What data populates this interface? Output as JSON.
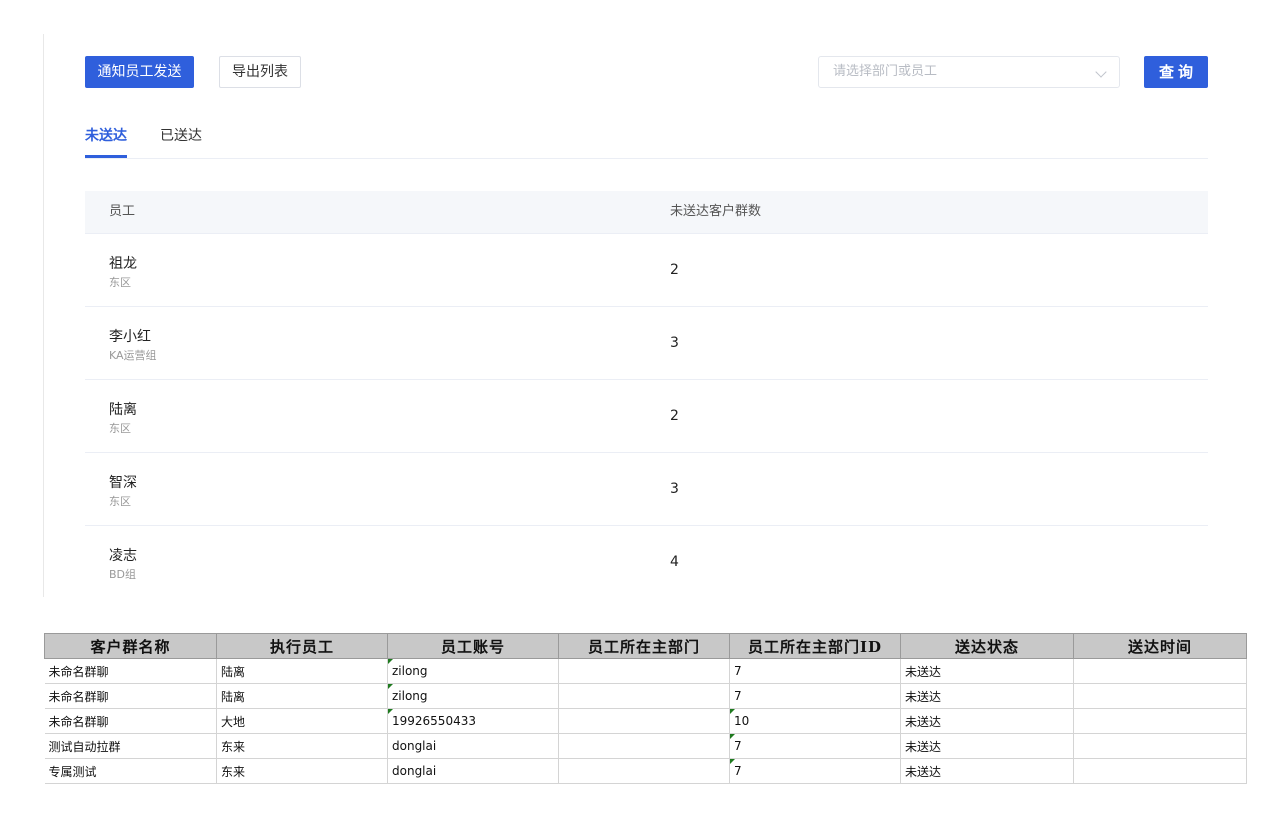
{
  "toolbar": {
    "notify_label": "通知员工发送",
    "export_label": "导出列表",
    "select_placeholder": "请选择部门或员工",
    "query_label": "查询"
  },
  "tabs": [
    {
      "label": "未送达",
      "active": true
    },
    {
      "label": "已送达",
      "active": false
    }
  ],
  "table": {
    "headers": [
      "员工",
      "未送达客户群数"
    ],
    "rows": [
      {
        "name": "祖龙",
        "dept": "东区",
        "count": "2"
      },
      {
        "name": "李小红",
        "dept": "KA运营组",
        "count": "3"
      },
      {
        "name": "陆离",
        "dept": "东区",
        "count": "2"
      },
      {
        "name": "智深",
        "dept": "东区",
        "count": "3"
      },
      {
        "name": "凌志",
        "dept": "BD组",
        "count": "4"
      }
    ]
  },
  "sheet": {
    "headers": [
      "客户群名称",
      "执行员工",
      "员工账号",
      "员工所在主部门",
      "员工所在主部门ID",
      "送达状态",
      "送达时间"
    ],
    "rows": [
      [
        "未命名群聊",
        "陆离",
        "zilong",
        "",
        "7",
        "未送达",
        ""
      ],
      [
        "未命名群聊",
        "陆离",
        "zilong",
        "",
        "7",
        "未送达",
        ""
      ],
      [
        "未命名群聊",
        "大地",
        "19926550433",
        "",
        "10",
        "未送达",
        ""
      ],
      [
        "测试自动拉群",
        "东来",
        "donglai",
        "",
        "7",
        "未送达",
        ""
      ],
      [
        "专属测试",
        "东来",
        "donglai",
        "",
        "7",
        "未送达",
        ""
      ]
    ],
    "number_marked": [
      [
        2
      ],
      [
        2
      ],
      [
        2,
        4
      ],
      [
        4
      ],
      [
        4
      ]
    ]
  },
  "colors": {
    "accent": "#2f5fdc",
    "header_bg": "#f5f7fa",
    "sheet_header_bg": "#c8c8c8",
    "number_marker": "#1f7a1f"
  }
}
